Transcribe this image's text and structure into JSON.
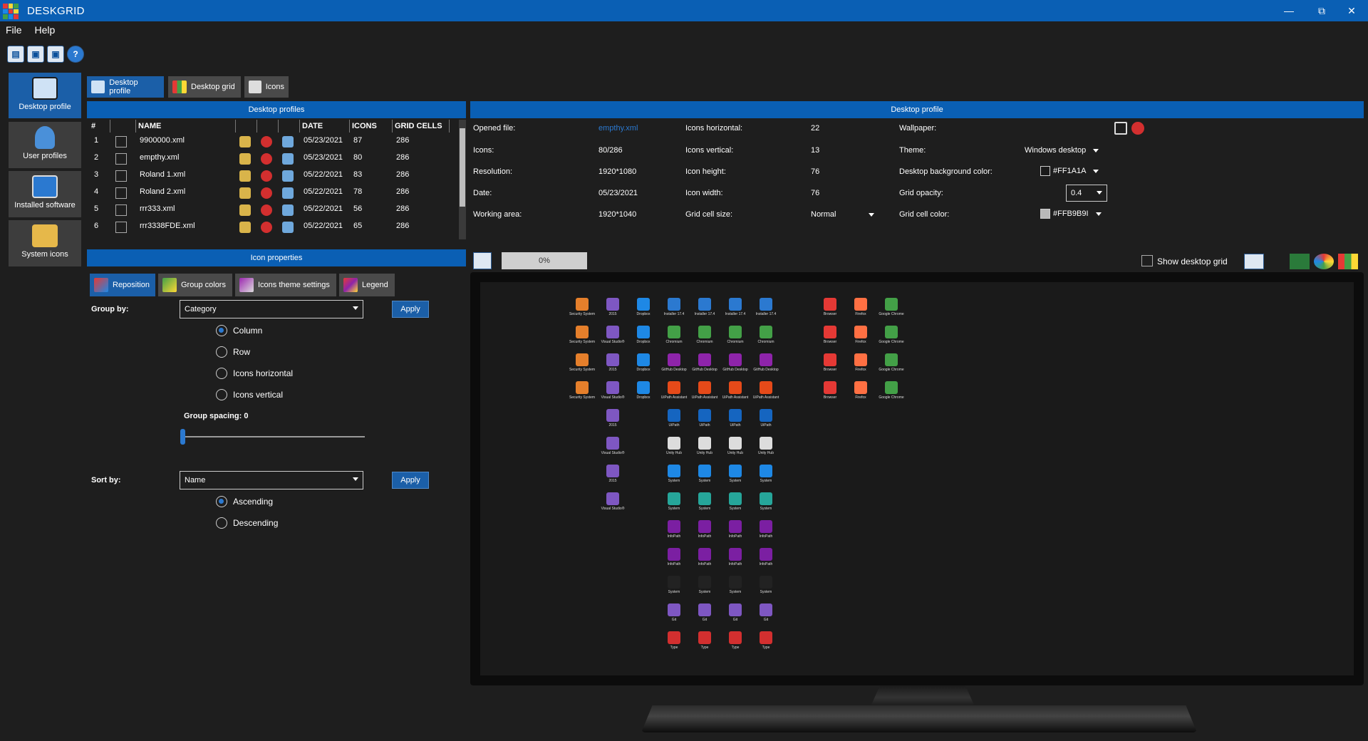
{
  "app": {
    "title": "DESKGRID"
  },
  "menu": [
    "File",
    "Help"
  ],
  "sidebar": [
    {
      "label": "Desktop profile"
    },
    {
      "label": "User profiles"
    },
    {
      "label": "Installed software"
    },
    {
      "label": "System icons"
    }
  ],
  "tabs": [
    "Desktop profile",
    "Desktop grid",
    "Icons"
  ],
  "profiles_panel": {
    "title": "Desktop profiles",
    "columns": [
      "#",
      "NAME",
      "DATE",
      "ICONS",
      "GRID CELLS"
    ],
    "rows": [
      {
        "n": "1",
        "name": "9900000.xml",
        "date": "05/23/2021",
        "icons": "87",
        "cells": "286"
      },
      {
        "n": "2",
        "name": "empthy.xml",
        "date": "05/23/2021",
        "icons": "80",
        "cells": "286"
      },
      {
        "n": "3",
        "name": "Roland 1.xml",
        "date": "05/22/2021",
        "icons": "83",
        "cells": "286"
      },
      {
        "n": "4",
        "name": "Roland 2.xml",
        "date": "05/22/2021",
        "icons": "78",
        "cells": "286"
      },
      {
        "n": "5",
        "name": "rrr333.xml",
        "date": "05/22/2021",
        "icons": "56",
        "cells": "286"
      },
      {
        "n": "6",
        "name": "rrr3338FDE.xml",
        "date": "05/22/2021",
        "icons": "65",
        "cells": "286"
      }
    ]
  },
  "icon_props": {
    "title": "Icon properties",
    "subtabs": [
      "Reposition",
      "Group colors",
      "Icons theme settings",
      "Legend"
    ],
    "group_by_label": "Group by:",
    "group_by_value": "Category",
    "apply": "Apply",
    "group_options": [
      "Column",
      "Row",
      "Icons horizontal",
      "Icons vertical"
    ],
    "group_spacing": "Group spacing: 0",
    "sort_by_label": "Sort by:",
    "sort_by_value": "Name",
    "sort_options": [
      "Ascending",
      "Descending"
    ]
  },
  "profile_detail": {
    "title": "Desktop profile",
    "opened_file_label": "Opened file:",
    "opened_file": "empthy.xml",
    "icons_label": "Icons:",
    "icons": "80/286",
    "resolution_label": "Resolution:",
    "resolution": "1920*1080",
    "date_label": "Date:",
    "date": "05/23/2021",
    "working_area_label": "Working area:",
    "working_area": "1920*1040",
    "icons_h_label": "Icons horizontal:",
    "icons_h": "22",
    "icons_v_label": "Icons vertical:",
    "icons_v": "13",
    "icon_height_label": "Icon height:",
    "icon_height": "76",
    "icon_width_label": "Icon width:",
    "icon_width": "76",
    "cell_size_label": "Grid cell size:",
    "cell_size": "Normal",
    "wallpaper_label": "Wallpaper:",
    "theme_label": "Theme:",
    "theme": "Windows desktop",
    "bg_color_label": "Desktop background color:",
    "bg_color": "#FF1A1A",
    "opacity_label": "Grid opacity:",
    "opacity": "0.4",
    "cell_color_label": "Grid cell color:",
    "cell_color": "#FFB9B9I"
  },
  "preview": {
    "progress": "0%",
    "show_grid": "Show desktop grid",
    "col_labels": {
      "c1": [
        "Security System",
        "Security System",
        "Security System",
        "Security System"
      ],
      "c2": [
        "2015",
        "Visual Studio®",
        "2015",
        "Visual Studio®",
        "2015",
        "Visual Studio®",
        "2015",
        "Visual Studio®"
      ],
      "c3": [
        "Dropbox",
        "Dropbox",
        "Dropbox",
        "Dropbox"
      ],
      "c4": [
        "Installer 17.4",
        "Chromium",
        "GitHub Desktop",
        "UiPath Assistant",
        "UiPath",
        "Unity Hub",
        "System",
        "System",
        "InfoPath",
        "InfoPath",
        "System",
        "Git",
        "Type"
      ],
      "c8": [
        "Browser",
        "Browser",
        "Browser",
        "Browser"
      ],
      "c9": [
        "Firefox",
        "Firefox",
        "Firefox",
        "Firefox"
      ],
      "c10": [
        "Google Chrome",
        "Google Chrome",
        "Google Chrome",
        "Google Chrome"
      ]
    }
  }
}
